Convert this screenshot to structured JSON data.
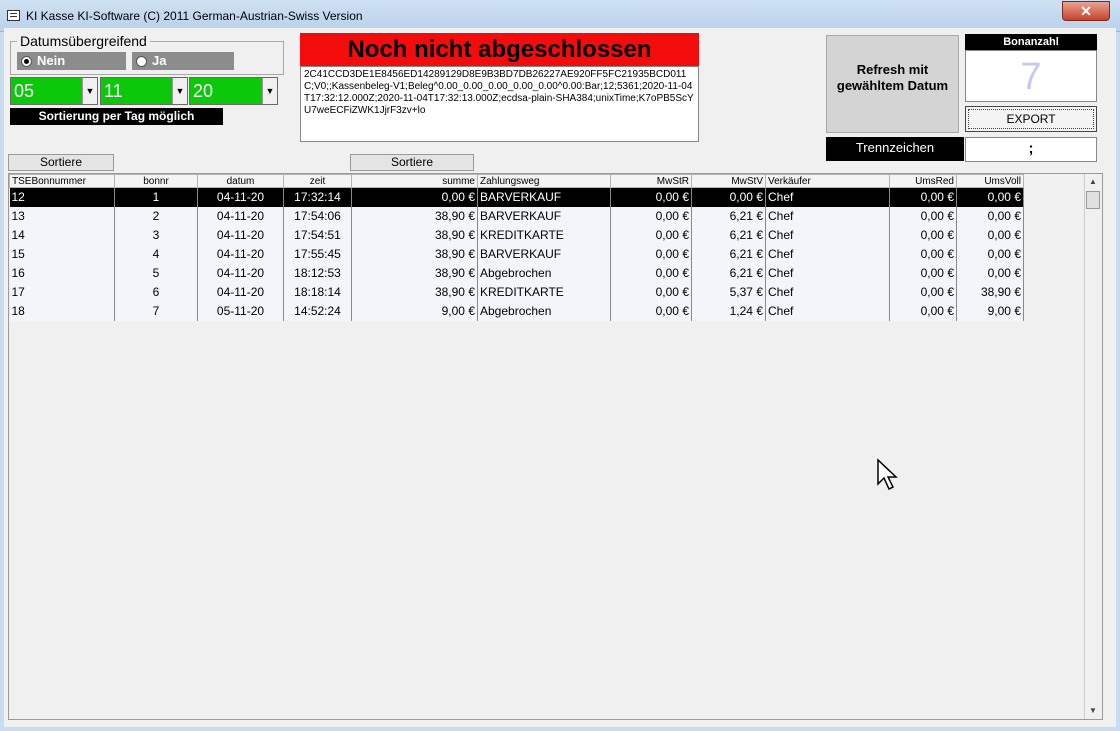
{
  "window": {
    "title": "KI Kasse  KI-Software (C) 2011 German-Austrian-Swiss Version",
    "close_label": "✕"
  },
  "filter": {
    "group_label": "Datumsübergreifend",
    "radio_no": "Nein",
    "radio_yes": "Ja",
    "selected": "Nein",
    "day": "05",
    "month": "11",
    "year": "20",
    "hint": "Sortierung per Tag möglich"
  },
  "status": {
    "banner": "Noch nicht abgeschlossen",
    "banner_color": "#f20c0c",
    "signature": "2C41CCD3DE1E8456ED14289129D8E9B3BD7DB26227AE920FF5FC21935BCD011C;V0;;Kassenbeleg-V1;Beleg^0.00_0.00_0.00_0.00_0.00^0.00:Bar;12;5361;2020-11-04T17:32:12.000Z;2020-11-04T17:32:13.000Z;ecdsa-plain-SHA384;unixTime;K7oPB5ScYU7weECFiZWK1JjrF3zv+lo"
  },
  "actions": {
    "refresh_label": "Refresh mit gewähltem Datum",
    "bon_label": "Bonanzahl",
    "bon_count": "7",
    "export_label": "EXPORT",
    "separator_label": "Trennzeichen",
    "separator_value": ";",
    "sort_left": "Sortiere",
    "sort_right": "Sortiere"
  },
  "table": {
    "columns": [
      "TSEBonnummer",
      "bonnr",
      "datum",
      "zeit",
      "summe",
      "Zahlungsweg",
      "MwStR",
      "MwStV",
      "Verkäufer",
      "UmsRed",
      "UmsVoll"
    ],
    "rows": [
      [
        "12",
        "1",
        "04-11-20",
        "17:32:14",
        "0,00 €",
        "BARVERKAUF",
        "0,00 €",
        "0,00 €",
        "Chef",
        "0,00 €",
        "0,00 €"
      ],
      [
        "13",
        "2",
        "04-11-20",
        "17:54:06",
        "38,90 €",
        "BARVERKAUF",
        "0,00 €",
        "6,21 €",
        "Chef",
        "0,00 €",
        "0,00 €"
      ],
      [
        "14",
        "3",
        "04-11-20",
        "17:54:51",
        "38,90 €",
        "KREDITKARTE",
        "0,00 €",
        "6,21 €",
        "Chef",
        "0,00 €",
        "0,00 €"
      ],
      [
        "15",
        "4",
        "04-11-20",
        "17:55:45",
        "38,90 €",
        "BARVERKAUF",
        "0,00 €",
        "6,21 €",
        "Chef",
        "0,00 €",
        "0,00 €"
      ],
      [
        "16",
        "5",
        "04-11-20",
        "18:12:53",
        "38,90 €",
        "Abgebrochen",
        "0,00 €",
        "6,21 €",
        "Chef",
        "0,00 €",
        "0,00 €"
      ],
      [
        "17",
        "6",
        "04-11-20",
        "18:18:14",
        "38,90 €",
        "KREDITKARTE",
        "0,00 €",
        "5,37 €",
        "Chef",
        "0,00 €",
        "38,90 €"
      ],
      [
        "18",
        "7",
        "05-11-20",
        "14:52:24",
        "9,00 €",
        "Abgebrochen",
        "0,00 €",
        "1,24 €",
        "Chef",
        "0,00 €",
        "9,00 €"
      ]
    ],
    "selected_row": 0
  },
  "icons": {
    "app": "app-icon",
    "close": "close-icon",
    "dropdown": "chevron-down-icon",
    "cursor": "mouse-pointer-icon"
  }
}
